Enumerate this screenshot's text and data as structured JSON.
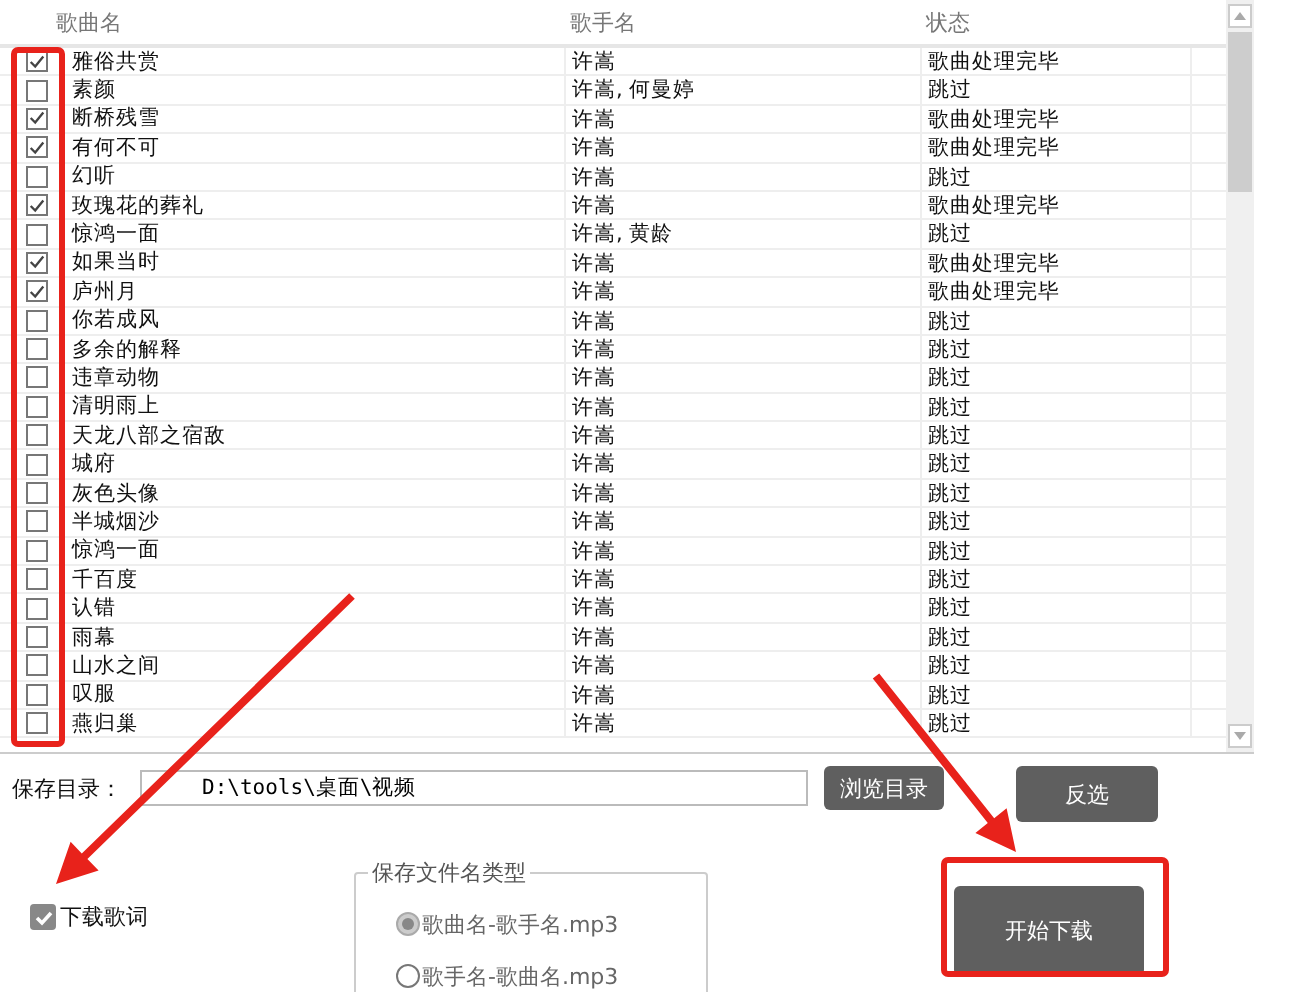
{
  "table": {
    "columns": [
      "歌曲名",
      "歌手名",
      "状态"
    ],
    "rows": [
      {
        "checked": true,
        "song": "雅俗共赏",
        "singer": "许嵩",
        "status": "歌曲处理完毕"
      },
      {
        "checked": false,
        "song": "素颜",
        "singer": "许嵩, 何曼婷",
        "status": "跳过"
      },
      {
        "checked": true,
        "song": "断桥残雪",
        "singer": "许嵩",
        "status": "歌曲处理完毕"
      },
      {
        "checked": true,
        "song": "有何不可",
        "singer": "许嵩",
        "status": "歌曲处理完毕"
      },
      {
        "checked": false,
        "song": "幻听",
        "singer": "许嵩",
        "status": "跳过"
      },
      {
        "checked": true,
        "song": "玫瑰花的葬礼",
        "singer": "许嵩",
        "status": "歌曲处理完毕"
      },
      {
        "checked": false,
        "song": "惊鸿一面",
        "singer": "许嵩, 黄龄",
        "status": "跳过"
      },
      {
        "checked": true,
        "song": "如果当时",
        "singer": "许嵩",
        "status": "歌曲处理完毕"
      },
      {
        "checked": true,
        "song": "庐州月",
        "singer": "许嵩",
        "status": "歌曲处理完毕"
      },
      {
        "checked": false,
        "song": "你若成风",
        "singer": "许嵩",
        "status": "跳过"
      },
      {
        "checked": false,
        "song": "多余的解释",
        "singer": "许嵩",
        "status": "跳过"
      },
      {
        "checked": false,
        "song": "违章动物",
        "singer": "许嵩",
        "status": "跳过"
      },
      {
        "checked": false,
        "song": "清明雨上",
        "singer": "许嵩",
        "status": "跳过"
      },
      {
        "checked": false,
        "song": "天龙八部之宿敌",
        "singer": "许嵩",
        "status": "跳过"
      },
      {
        "checked": false,
        "song": "城府",
        "singer": "许嵩",
        "status": "跳过"
      },
      {
        "checked": false,
        "song": "灰色头像",
        "singer": "许嵩",
        "status": "跳过"
      },
      {
        "checked": false,
        "song": "半城烟沙",
        "singer": "许嵩",
        "status": "跳过"
      },
      {
        "checked": false,
        "song": "惊鸿一面",
        "singer": "许嵩",
        "status": "跳过"
      },
      {
        "checked": false,
        "song": "千百度",
        "singer": "许嵩",
        "status": "跳过"
      },
      {
        "checked": false,
        "song": "认错",
        "singer": "许嵩",
        "status": "跳过"
      },
      {
        "checked": false,
        "song": "雨幕",
        "singer": "许嵩",
        "status": "跳过"
      },
      {
        "checked": false,
        "song": "山水之间",
        "singer": "许嵩",
        "status": "跳过"
      },
      {
        "checked": false,
        "song": "叹服",
        "singer": "许嵩",
        "status": "跳过"
      },
      {
        "checked": false,
        "song": "燕归巢",
        "singer": "许嵩",
        "status": "跳过"
      }
    ]
  },
  "save_dir": {
    "label": "保存目录：",
    "value": "D:\\tools\\桌面\\视频"
  },
  "buttons": {
    "browse": "浏览目录",
    "invert": "反选",
    "start": "开始下载"
  },
  "download_lyrics": {
    "label": "下载歌词",
    "checked": true
  },
  "filename_type": {
    "title": "保存文件名类型",
    "options": [
      {
        "label": "歌曲名-歌手名.mp3",
        "selected": true
      },
      {
        "label": "歌手名-歌曲名.mp3",
        "selected": false
      }
    ]
  }
}
